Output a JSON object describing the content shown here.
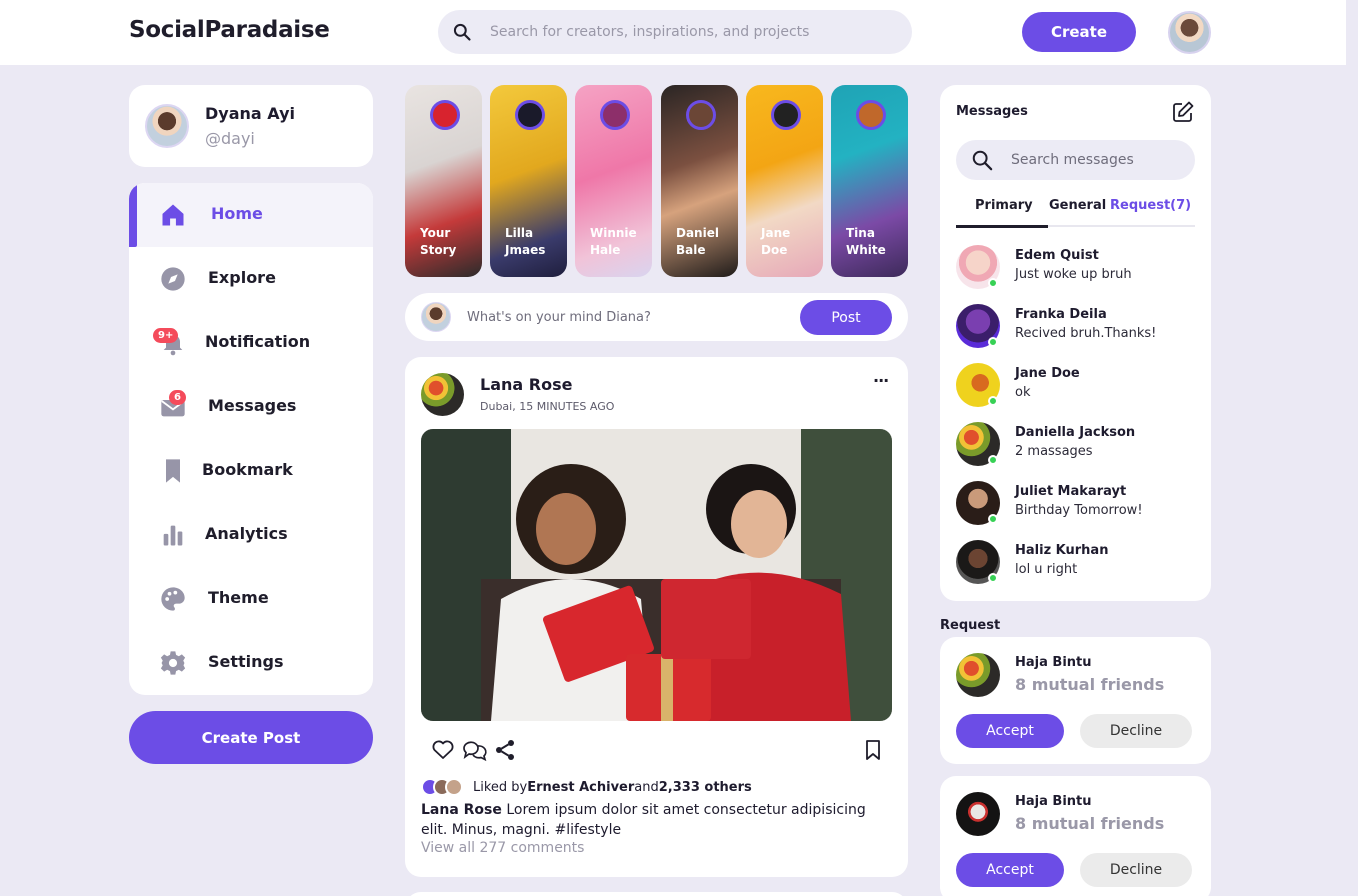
{
  "brand": {
    "name": "SocialParadaise",
    "accent": "#6c4de6"
  },
  "search": {
    "placeholder": "Search for creators, inspirations, and projects"
  },
  "nav": {
    "create_label": "Create"
  },
  "profile": {
    "name": "Dyana Ayi",
    "handle": "@dayi"
  },
  "sidebar": {
    "items": [
      {
        "label": "Home",
        "icon": "home-icon",
        "active": true
      },
      {
        "label": "Explore",
        "icon": "compass-icon"
      },
      {
        "label": "Notification",
        "icon": "bell-icon",
        "badge": "9+"
      },
      {
        "label": "Messages",
        "icon": "envelope-icon",
        "badge": "6"
      },
      {
        "label": "Bookmark",
        "icon": "bookmark-icon"
      },
      {
        "label": "Analytics",
        "icon": "bar-chart-icon"
      },
      {
        "label": "Theme",
        "icon": "palette-icon"
      },
      {
        "label": "Settings",
        "icon": "gear-icon"
      }
    ],
    "create_post_label": "Create Post"
  },
  "stories": [
    {
      "name": "Your Story"
    },
    {
      "name": "Lilla Jmaes"
    },
    {
      "name": "Winnie Hale"
    },
    {
      "name": "Daniel Bale"
    },
    {
      "name": "Jane Doe"
    },
    {
      "name": "Tina White"
    }
  ],
  "composer": {
    "placeholder": "What's on your mind Diana?",
    "post_label": "Post"
  },
  "feed": {
    "post": {
      "author": "Lana Rose",
      "location_time": "Dubai, 15 MINUTES AGO",
      "more": "···",
      "liked_prefix": "Liked by ",
      "liked_name": "Ernest Achiver",
      "liked_and": "and ",
      "liked_count": "2,333 others",
      "caption_author": "Lana Rose",
      "caption_text": " Lorem ipsum dolor sit amet consectetur adipisicing elit. Minus, magni. #lifestyle",
      "view_all": "View all 277 comments"
    }
  },
  "messages": {
    "title": "Messages",
    "search_placeholder": "Search messages",
    "tabs": [
      "Primary",
      "General",
      "Request(7)"
    ],
    "items": [
      {
        "name": "Edem Quist",
        "text": "Just woke up bruh",
        "online": true
      },
      {
        "name": "Franka Deila",
        "text": "Recived bruh.Thanks!",
        "online": true
      },
      {
        "name": "Jane Doe",
        "text": "ok",
        "online": true
      },
      {
        "name": "Daniella Jackson",
        "text": "2 massages",
        "online": true
      },
      {
        "name": "Juliet Makarayt",
        "text": "Birthday Tomorrow!",
        "online": true
      },
      {
        "name": "Haliz Kurhan",
        "text": "lol u right",
        "online": true
      }
    ]
  },
  "requests": {
    "title": "Request",
    "items": [
      {
        "name": "Haja Bintu",
        "mutual": "8 mutual friends",
        "accept": "Accept",
        "decline": "Decline"
      },
      {
        "name": "Haja Bintu",
        "mutual": "8 mutual friends",
        "accept": "Accept",
        "decline": "Decline"
      }
    ]
  }
}
